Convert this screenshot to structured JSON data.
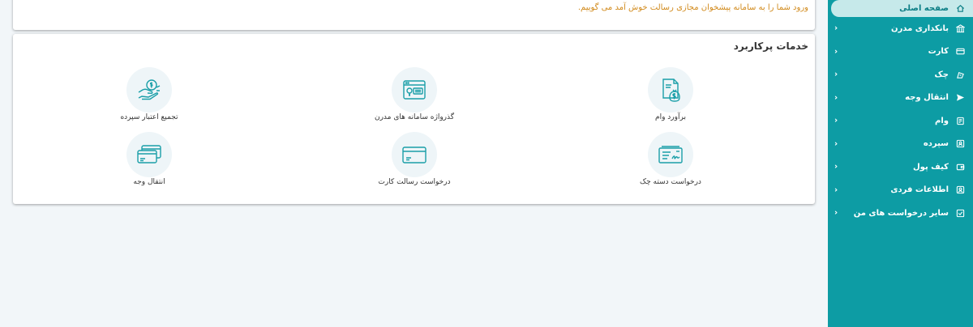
{
  "welcome": {
    "message": "ورود شما را به سامانه پیشخوان مجازی رسالت خوش آمد می گوییم."
  },
  "services": {
    "title": "خدمات پرکاربرد",
    "items": [
      {
        "label": "برآورد وام",
        "icon": "loan-bag-icon"
      },
      {
        "label": "گذرواژه سامانه های مدرن",
        "icon": "password-card-icon"
      },
      {
        "label": "تجمیع اعتبار سپرده",
        "icon": "hand-money-icon"
      },
      {
        "label": "درخواست دسته چک",
        "icon": "checkbook-icon"
      },
      {
        "label": "درخواست رسالت کارت",
        "icon": "card-icon"
      },
      {
        "label": "انتقال وجه",
        "icon": "cards-transfer-icon"
      }
    ]
  },
  "sidebar": {
    "items": [
      {
        "label": "صفحه اصلی",
        "icon": "home-icon",
        "active": true
      },
      {
        "label": "بانکداری مدرن",
        "icon": "bank-icon"
      },
      {
        "label": "کارت",
        "icon": "card-icon"
      },
      {
        "label": "چک",
        "icon": "cheque-icon"
      },
      {
        "label": "انتقال وجه",
        "icon": "send-icon"
      },
      {
        "label": "وام",
        "icon": "loan-icon"
      },
      {
        "label": "سپرده",
        "icon": "deposit-icon"
      },
      {
        "label": "کیف پول",
        "icon": "wallet-icon"
      },
      {
        "label": "اطلاعات فردی",
        "icon": "profile-icon"
      },
      {
        "label": "سایر درخواست های من",
        "icon": "checklist-icon"
      }
    ],
    "chevron": "‹"
  },
  "colors": {
    "sidebar": "#0d9ca4",
    "welcome_text": "#d18a1c",
    "icon_stroke": "#1a9fa8"
  }
}
